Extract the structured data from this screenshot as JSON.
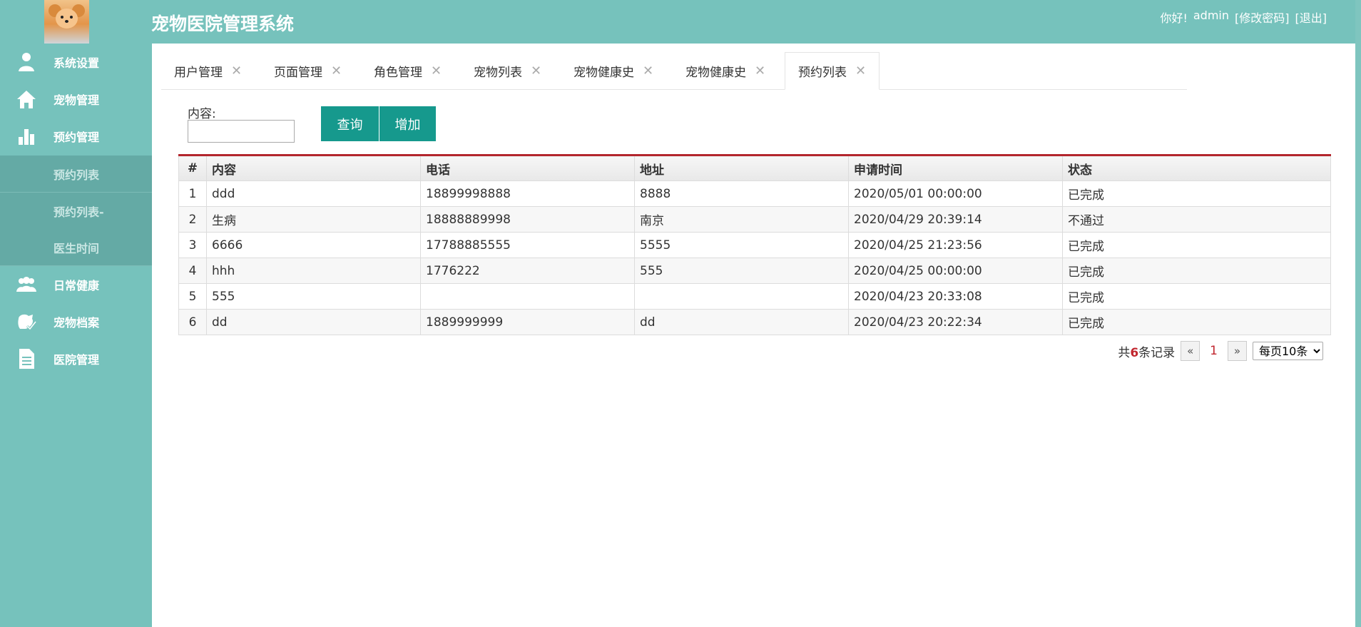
{
  "header": {
    "title": "宠物医院管理系统",
    "greeting": "你好!",
    "username": "admin",
    "change_password": "[修改密码]",
    "logout": "[退出]"
  },
  "sidebar": {
    "items": [
      {
        "label": "系统设置",
        "icon": "user-settings-icon"
      },
      {
        "label": "宠物管理",
        "icon": "home-icon"
      },
      {
        "label": "预约管理",
        "icon": "bar-chart-icon"
      },
      {
        "label": "日常健康",
        "icon": "group-icon"
      },
      {
        "label": "宠物档案",
        "icon": "pet-check-icon"
      },
      {
        "label": "医院管理",
        "icon": "document-icon"
      }
    ],
    "subitems": [
      "预约列表",
      "预约列表-",
      "医生时间"
    ]
  },
  "tabs": [
    {
      "label": "用户管理"
    },
    {
      "label": "页面管理"
    },
    {
      "label": "角色管理"
    },
    {
      "label": "宠物列表"
    },
    {
      "label": "宠物健康史"
    },
    {
      "label": "宠物健康史"
    },
    {
      "label": "预约列表",
      "active": true
    }
  ],
  "search": {
    "label": "内容:",
    "value": "",
    "query_button": "查询",
    "add_button": "增加"
  },
  "table": {
    "headers": [
      "#",
      "内容",
      "电话",
      "地址",
      "申请时间",
      "状态"
    ],
    "rows": [
      [
        "1",
        "ddd",
        "18899998888",
        "8888",
        "2020/05/01 00:00:00",
        "已完成"
      ],
      [
        "2",
        "生病",
        "18888889998",
        "南京",
        "2020/04/29 20:39:14",
        "不通过"
      ],
      [
        "3",
        "6666",
        "17788885555",
        "5555",
        "2020/04/25 21:23:56",
        "已完成"
      ],
      [
        "4",
        "hhh",
        "1776222",
        "555",
        "2020/04/25 00:00:00",
        "已完成"
      ],
      [
        "5",
        "555",
        "",
        "",
        "2020/04/23 20:33:08",
        "已完成"
      ],
      [
        "6",
        "dd",
        "1889999999",
        "dd",
        "2020/04/23 20:22:34",
        "已完成"
      ]
    ]
  },
  "pagination": {
    "prefix": "共",
    "count": "6",
    "suffix": "条记录",
    "prev": "«",
    "page": "1",
    "next": "»",
    "page_size": "每页10条"
  },
  "colors": {
    "accent": "#76c2bc",
    "button": "#16998d",
    "table_top_border": "#b3262d"
  }
}
